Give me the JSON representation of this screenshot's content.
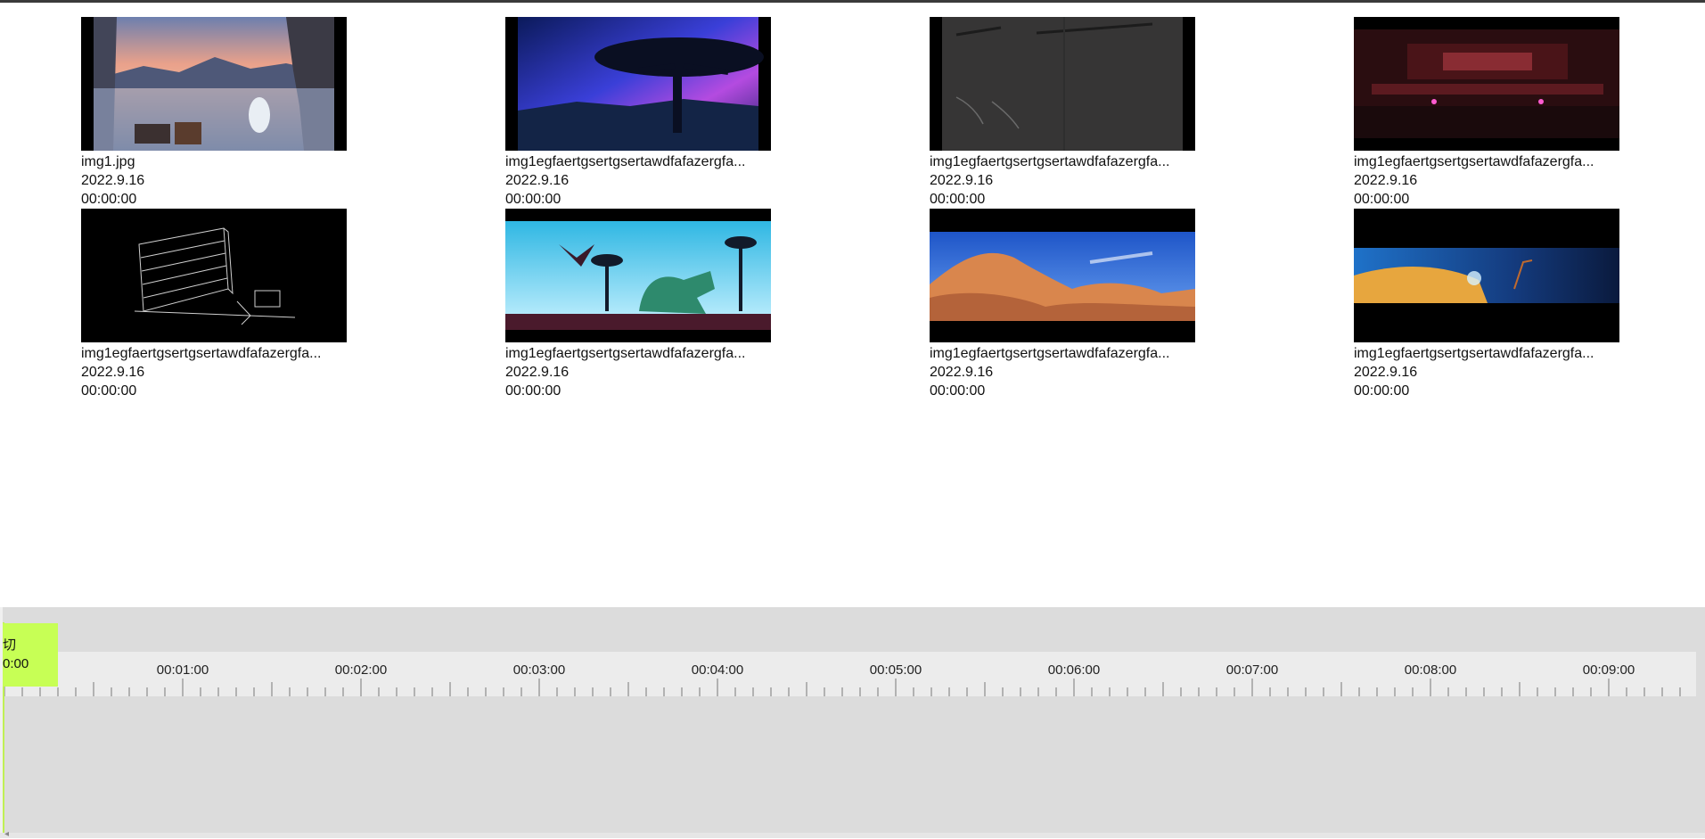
{
  "media": {
    "items": [
      {
        "name": "img1.jpg",
        "date": "2022.9.16",
        "time": "00:00:00",
        "thumb_icon": "harbor-sunset-thumbnail"
      },
      {
        "name": "img1egfaertgsertgsertawdfafazergfa...",
        "date": "2022.9.16",
        "time": "00:00:00",
        "thumb_icon": "aurora-tree-thumbnail"
      },
      {
        "name": "img1egfaertgsertgsertawdfafazergfa...",
        "date": "2022.9.16",
        "time": "00:00:00",
        "thumb_icon": "concrete-wall-thumbnail"
      },
      {
        "name": "img1egfaertgsertgsertawdfafazergfa...",
        "date": "2022.9.16",
        "time": "00:00:00",
        "thumb_icon": "neon-street-thumbnail"
      },
      {
        "name": "img1egfaertgsertgsertawdfafazergfa...",
        "date": "2022.9.16",
        "time": "00:00:00",
        "thumb_icon": "line-sketch-shelf-thumbnail"
      },
      {
        "name": "img1egfaertgsertgsertawdfafazergfa...",
        "date": "2022.9.16",
        "time": "00:00:00",
        "thumb_icon": "dinosaur-eagle-thumbnail"
      },
      {
        "name": "img1egfaertgsertgsertawdfafazergfa...",
        "date": "2022.9.16",
        "time": "00:00:00",
        "thumb_icon": "desert-rocks-thumbnail"
      },
      {
        "name": "img1egfaertgsertgsertawdfafazergfa...",
        "date": "2022.9.16",
        "time": "00:00:00",
        "thumb_icon": "planet-horizon-thumbnail"
      }
    ]
  },
  "timeline": {
    "marker": {
      "label": "切",
      "time": "0:00",
      "color": "#c7ff55"
    },
    "ruler_labels": [
      "00:01:00",
      "00:02:00",
      "00:03:00",
      "00:04:00",
      "00:05:00",
      "00:06:00",
      "00:07:00",
      "00:08:00",
      "00:09:00"
    ],
    "panel_color": "#dcdcdc",
    "ruler_color": "#ececec"
  }
}
